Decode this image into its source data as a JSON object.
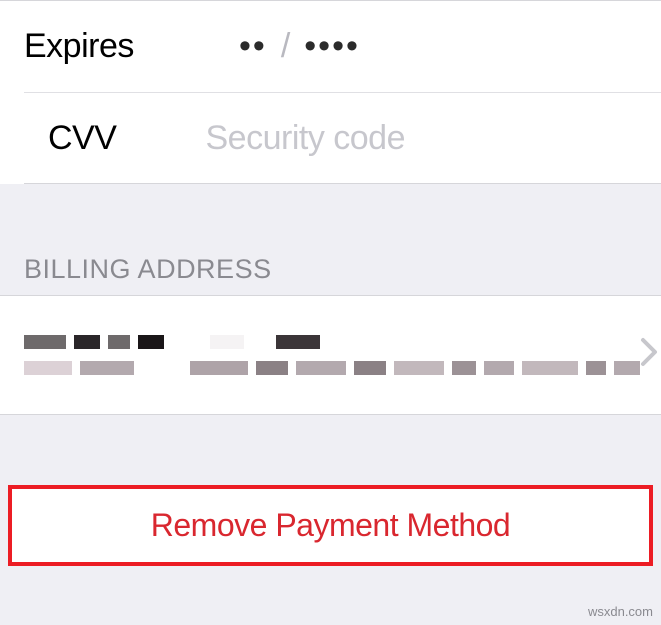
{
  "card": {
    "expires_label": "Expires",
    "expires_month_mask": "••",
    "expires_slash": "/",
    "expires_year_mask": "••••",
    "cvv_label": "CVV",
    "cvv_placeholder": "Security code"
  },
  "billing": {
    "header": "BILLING ADDRESS"
  },
  "actions": {
    "remove_label": "Remove Payment Method"
  },
  "watermark": "wsxdn.com"
}
